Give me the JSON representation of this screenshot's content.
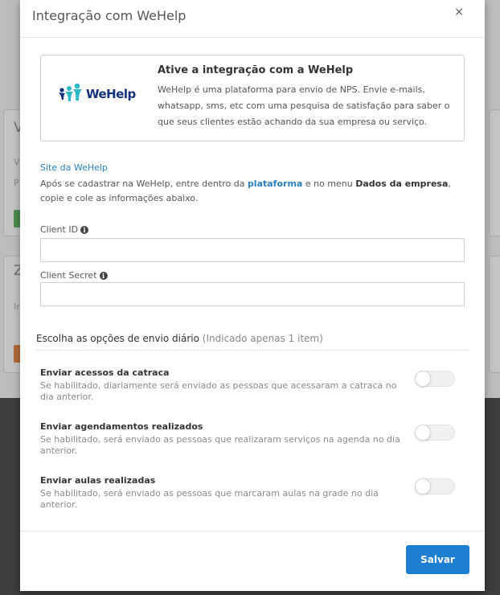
{
  "modal": {
    "title": "Integração com WeHelp",
    "close_label": "×"
  },
  "integration": {
    "logo_text": "WeHelp",
    "title": "Ative a integração com a WeHelp",
    "description": "WeHelp é uma plataforma para envio de NPS. Envie e-mails, whatsapp, sms, etc com uma pesquisa de satisfação para saber o que seus clientes estão achando da sua empresa ou serviço."
  },
  "site_link": "Site da WeHelp",
  "instructions": {
    "part1": "Após se cadastrar na WeHelp, entre dentro da ",
    "link": "plataforma",
    "part2": " e no menu ",
    "menu": "Dados da empresa",
    "part3": ", copie e cole as informações abaixo."
  },
  "fields": {
    "client_id": {
      "label": "Client ID",
      "value": "",
      "placeholder": ""
    },
    "client_secret": {
      "label": "Client Secret",
      "value": "",
      "placeholder": ""
    }
  },
  "options_section": {
    "title": "Escolha as opções de envio diário",
    "note": "(Indicado apenas 1 item)"
  },
  "options": [
    {
      "title": "Enviar acessos da catraca",
      "description": "Se habilitado, diariamente será enviado as pessoas que acessaram a catraca no dia anterior.",
      "enabled": false
    },
    {
      "title": "Enviar agendamentos realizados",
      "description": "Se habilitado, será enviado as pessoas que realizaram serviços na agenda no dia anterior.",
      "enabled": false
    },
    {
      "title": "Enviar aulas realizadas",
      "description": "Se habilitado, será enviado as pessoas que marcaram aulas na grade no dia anterior.",
      "enabled": false
    }
  ],
  "footer": {
    "save_label": "Salvar"
  },
  "colors": {
    "primary": "#1e7fd1",
    "link": "#2a7fc0",
    "logo": "#13307a"
  }
}
